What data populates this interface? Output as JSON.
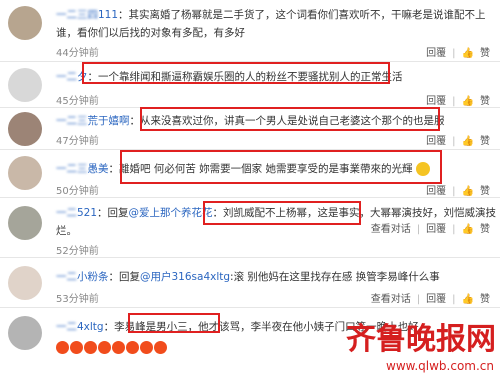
{
  "comments": [
    {
      "user_tail": "111",
      "text": "：其实离婚了杨幂就是二手货了，这个词看你们喜欢听不，干嘛老是说谁配不上",
      "text2": "谁，看你们以后找的对象有多配，有多好",
      "time": "44分钟前",
      "actions": [
        "回覆",
        "赞"
      ]
    },
    {
      "user_tail": "夕",
      "text": "一个靠绯闻和撕逼称霸娱乐圈的人的粉丝不要骚扰别人的正常生活",
      "time": "45分钟前",
      "actions": [
        "回覆",
        "赞"
      ]
    },
    {
      "user_tail": "荒于嬉啊",
      "text": "：从来没喜欢过你，讲真一个男人是处说自己老婆这个那个的也是服",
      "time": "47分钟前",
      "actions": [
        "回覆",
        "赞"
      ]
    },
    {
      "user_tail": "愚美",
      "text": "離婚吧 何必何苦 妳需要一個家 她需要享受的是事業帶來的光輝",
      "time": "50分钟前",
      "actions": [
        "回覆",
        "赞"
      ]
    },
    {
      "user_tail": "521",
      "reply_prefix": "：回复",
      "reply_to": "@爱上那个养花花",
      "text": "刘凯威配不上杨幂，这是事实，",
      "text_after": "大幂幂演技好，刘恺威演技",
      "text2": "烂。",
      "time": "52分钟前",
      "actions": [
        "查看对话",
        "回覆",
        "赞"
      ]
    },
    {
      "user_tail": "小粉条",
      "reply_prefix": "：回复",
      "reply_to": "@用户316sa4xltg",
      "text": ":滚   别他妈在这里找存在感   换管李易峰什么事",
      "time": "53分钟前",
      "actions": [
        "查看对话",
        "回覆",
        "赞"
      ]
    },
    {
      "user_tail": "4xltg",
      "text": "李易峰是男小三",
      "text_after": "他才该骂，李半夜在他小姨子门口等一晚上也好",
      "time": "",
      "actions": []
    }
  ],
  "watermark": {
    "title": "齐鲁晚报网",
    "url": "www.qlwb.com.cn"
  },
  "colors": {
    "link": "#2b66c0",
    "highlight": "#e02020",
    "watermark": "#d51f1f"
  }
}
